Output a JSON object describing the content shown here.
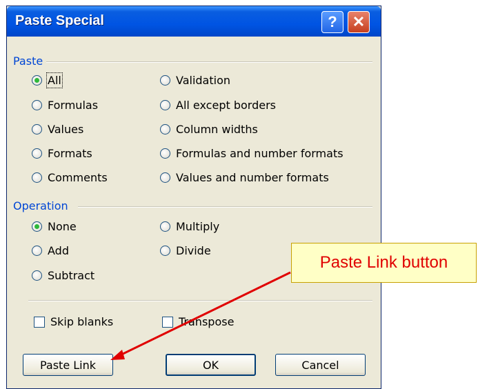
{
  "dialog": {
    "title": "Paste Special",
    "help_glyph": "?",
    "close_glyph": "✕"
  },
  "paste_group": {
    "label": "Paste",
    "left_options": [
      {
        "label": "All",
        "selected": true
      },
      {
        "label": "Formulas",
        "selected": false
      },
      {
        "label": "Values",
        "selected": false
      },
      {
        "label": "Formats",
        "selected": false
      },
      {
        "label": "Comments",
        "selected": false
      }
    ],
    "right_options": [
      {
        "label": "Validation",
        "selected": false
      },
      {
        "label": "All except borders",
        "selected": false
      },
      {
        "label": "Column widths",
        "selected": false
      },
      {
        "label": "Formulas and number formats",
        "selected": false
      },
      {
        "label": "Values and number formats",
        "selected": false
      }
    ]
  },
  "operation_group": {
    "label": "Operation",
    "options": [
      {
        "label": "None",
        "selected": true
      },
      {
        "label": "Multiply",
        "selected": false
      },
      {
        "label": "Add",
        "selected": false
      },
      {
        "label": "Divide",
        "selected": false
      },
      {
        "label": "Subtract",
        "selected": false
      }
    ]
  },
  "checkboxes": {
    "skip_blanks": {
      "label": "Skip blanks",
      "checked": false
    },
    "transpose": {
      "label": "Transpose",
      "checked": false
    }
  },
  "buttons": {
    "paste_link": "Paste Link",
    "ok": "OK",
    "cancel": "Cancel"
  },
  "annotation": {
    "callout_text": "Paste Link button",
    "arrow_color": "#e00000"
  },
  "colors": {
    "title_bar": "#0054e3",
    "group_label": "#0046d5",
    "dialog_face": "#ece9d8"
  }
}
